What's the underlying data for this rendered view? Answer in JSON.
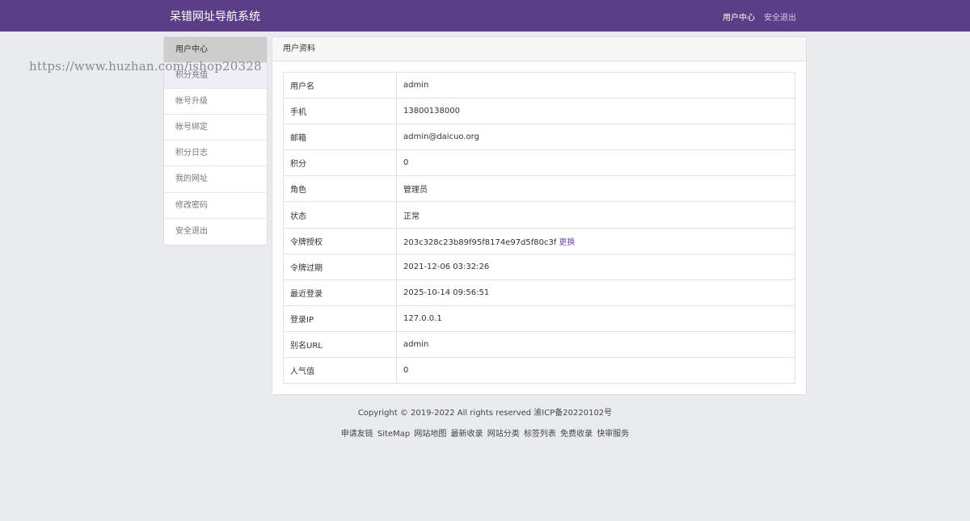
{
  "navbar": {
    "brand": "呆错网址导航系统",
    "links": [
      "用户中心",
      "安全退出"
    ]
  },
  "watermark": "https://www.huzhan.com/ishop20328",
  "sidebar": {
    "items": [
      "用户中心",
      "积分充值",
      "帐号升级",
      "帐号绑定",
      "积分日志",
      "我的网址",
      "修改密码",
      "安全退出"
    ]
  },
  "panel": {
    "title": "用户资料",
    "rows": [
      {
        "label": "用户名",
        "value": "admin"
      },
      {
        "label": "手机",
        "value": "13800138000"
      },
      {
        "label": "邮箱",
        "value": "admin@daicuo.org"
      },
      {
        "label": "积分",
        "value": "0"
      },
      {
        "label": "角色",
        "value": "管理员"
      },
      {
        "label": "状态",
        "value": "正常"
      },
      {
        "label": "令牌授权",
        "value": "203c328c23b89f95f8174e97d5f80c3f",
        "action": "更换"
      },
      {
        "label": "令牌过期",
        "value": "2021-12-06 03:32:26"
      },
      {
        "label": "最近登录",
        "value": "2025-10-14 09:56:51"
      },
      {
        "label": "登录IP",
        "value": "127.0.0.1"
      },
      {
        "label": "别名URL",
        "value": "admin"
      },
      {
        "label": "人气值",
        "value": "0"
      }
    ]
  },
  "footer": {
    "copyright": "Copyright © 2019-2022 All rights reserved 渝ICP备20220102号",
    "links": [
      "申请友链",
      "SiteMap",
      "网站地图",
      "最新收录",
      "网站分类",
      "标签列表",
      "免费收录",
      "快审服务"
    ]
  }
}
